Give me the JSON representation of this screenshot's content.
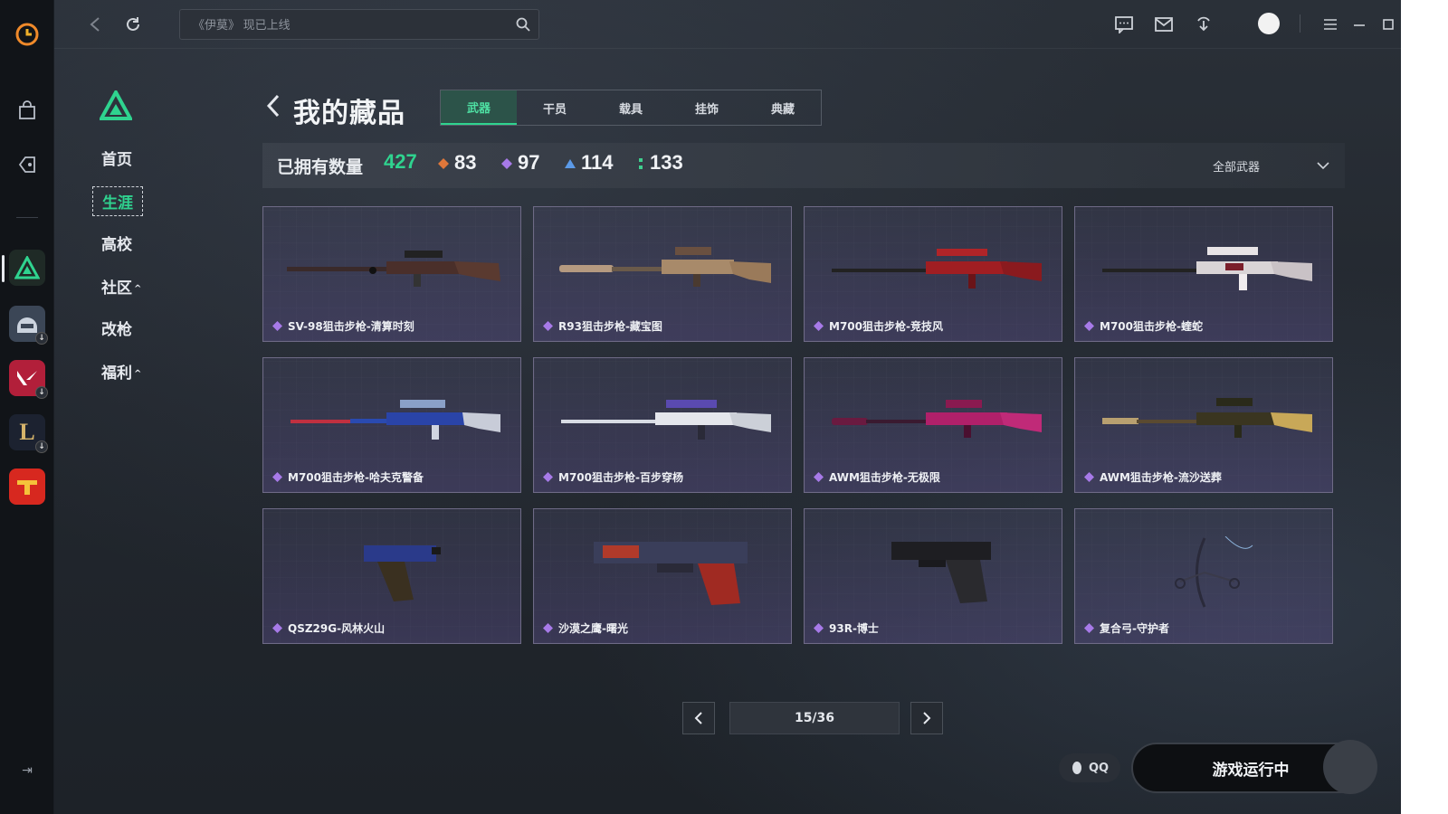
{
  "search": {
    "placeholder": "《伊莫》 现已上线"
  },
  "nav": {
    "items": [
      {
        "label": "首页"
      },
      {
        "label": "生涯"
      },
      {
        "label": "高校"
      },
      {
        "label": "社区"
      },
      {
        "label": "改枪"
      },
      {
        "label": "福利"
      }
    ],
    "active": "生涯"
  },
  "page": {
    "title": "我的藏品",
    "tabs": [
      "武器",
      "干员",
      "载具",
      "挂饰",
      "典藏"
    ],
    "active_tab": "武器"
  },
  "stats": {
    "owned_label": "已拥有数量",
    "total": "427",
    "counts": [
      {
        "value": "83",
        "color": "#e0773a"
      },
      {
        "value": "97",
        "color": "#a77ae8"
      },
      {
        "value": "114",
        "color": "#5b9ae8"
      },
      {
        "value": "133",
        "color": "#3fcf8e"
      }
    ],
    "filter_label": "全部武器"
  },
  "items": [
    {
      "name": "SV-98狙击步枪-清算时刻"
    },
    {
      "name": "R93狙击步枪-藏宝图"
    },
    {
      "name": "M700狙击步枪-竞技风"
    },
    {
      "name": "M700狙击步枪-蝰蛇"
    },
    {
      "name": "M700狙击步枪-哈夫克警备"
    },
    {
      "name": "M700狙击步枪-百步穿杨"
    },
    {
      "name": "AWM狙击步枪-无极限"
    },
    {
      "name": "AWM狙击步枪-流沙送葬"
    },
    {
      "name": "QSZ29G-风林火山"
    },
    {
      "name": "沙漠之鹰-曙光"
    },
    {
      "name": "93R-博士"
    },
    {
      "name": "复合弓-守护者"
    }
  ],
  "pager": {
    "label": "15/36"
  },
  "footer": {
    "qq_label": "QQ",
    "game_status": "游戏运行中"
  },
  "colors": {
    "accent": "#2fd38f",
    "rarity_purple": "#a77ae8"
  }
}
